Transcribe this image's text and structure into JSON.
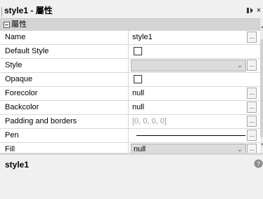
{
  "window": {
    "title": "style1 - 屬性",
    "restore_icon": "restore-panel-icon",
    "close_icon": "close-icon",
    "close_glyph": "×"
  },
  "grid": {
    "category": {
      "label": "屬性",
      "toggle": "collapse-toggle"
    },
    "properties": [
      {
        "name": "Name",
        "value": "style1",
        "editor": "text-with-button"
      },
      {
        "name": "Default Style",
        "value": "",
        "editor": "checkbox",
        "checked": false
      },
      {
        "name": "Style",
        "value": "",
        "editor": "combo-with-button"
      },
      {
        "name": "Opaque",
        "value": "",
        "editor": "checkbox",
        "checked": false
      },
      {
        "name": "Forecolor",
        "value": "null",
        "editor": "text-with-button"
      },
      {
        "name": "Backcolor",
        "value": "null",
        "editor": "text-with-button"
      },
      {
        "name": "Padding and borders",
        "value": "[0, 0, 0, 0]",
        "editor": "text-with-button",
        "dimmed": true
      },
      {
        "name": "Pen",
        "value": "",
        "editor": "pen-with-button"
      },
      {
        "name": "Fill",
        "value": "null",
        "editor": "combo-with-button"
      }
    ],
    "ellipsis_label": "...",
    "combo_chevron": "⌄"
  },
  "description": {
    "title": "style1",
    "help_icon": "help-icon"
  },
  "colors": {
    "grid_line": "#d8d8d8",
    "category_bg": "#d4d4d4",
    "panel_bg": "#f0f0f0",
    "dim_text": "#9a9a9a"
  }
}
